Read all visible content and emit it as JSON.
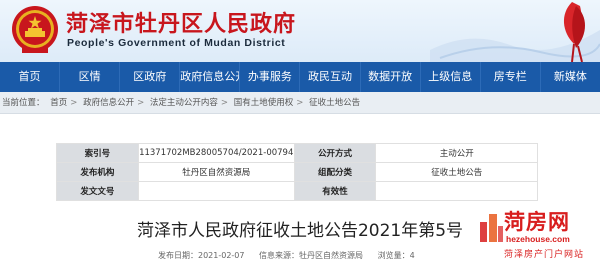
{
  "header": {
    "title_cn": "菏泽市牡丹区人民政府",
    "title_en": "People's Government of Mudan District"
  },
  "nav": {
    "items": [
      "首页",
      "区情",
      "区政府",
      "政府信息公开",
      "办事服务",
      "政民互动",
      "数据开放",
      "上级信息",
      "房专栏",
      "新媒体"
    ]
  },
  "breadcrumb": {
    "prefix": "当前位置：",
    "items": [
      "首页",
      "政府信息公开",
      "法定主动公开内容",
      "国有土地使用权",
      "征收土地公告"
    ],
    "separator": ">"
  },
  "meta": {
    "rows": [
      [
        "索引号",
        "11371702MB28005704/2021-00794",
        "公开方式",
        "主动公开"
      ],
      [
        "发布机构",
        "牡丹区自然资源局",
        "组配分类",
        "征收土地公告"
      ],
      [
        "发文文号",
        "",
        "有效性",
        ""
      ]
    ]
  },
  "article": {
    "title": "菏泽市人民政府征收土地公告2021年第5号",
    "date_label": "发布日期：2021-02-07",
    "source_label": "信息来源：牡丹区自然资源局",
    "views_label": "浏览量：",
    "views": "4"
  },
  "watermark": {
    "brand": "菏房网",
    "url": "hezehouse.com",
    "sub": "菏泽房产门户网站"
  },
  "colors": {
    "brand_red": "#c8161d",
    "nav_blue": "#1a5aa8",
    "meta_key_bg": "#dadde1"
  }
}
